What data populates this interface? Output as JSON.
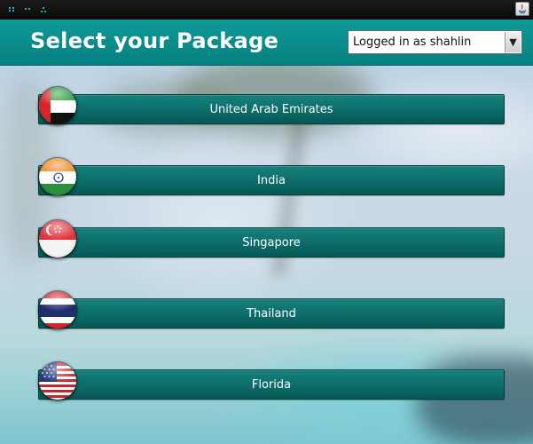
{
  "header": {
    "title": "Select your Package",
    "user_select_value": "Logged in as shahlin",
    "accent_color": "#0a8f8e"
  },
  "packages": [
    {
      "label": "United Arab Emirates",
      "flag_icon": "uae-flag-icon"
    },
    {
      "label": "India",
      "flag_icon": "india-flag-icon"
    },
    {
      "label": "Singapore",
      "flag_icon": "singapore-flag-icon"
    },
    {
      "label": "Thailand",
      "flag_icon": "thailand-flag-icon"
    },
    {
      "label": "Florida",
      "flag_icon": "usa-flag-icon"
    }
  ],
  "titlebar": {
    "app_icon": "java-app-icon"
  }
}
